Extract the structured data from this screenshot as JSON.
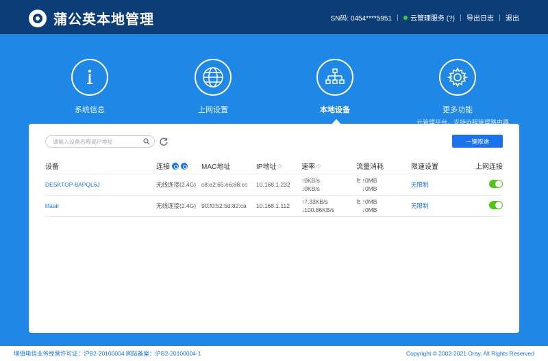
{
  "header": {
    "title": "蒲公英本地管理",
    "sn_label": "SN码: 0454****5951",
    "cloud_service": "云管理服务 (?)",
    "export_log": "导出日志",
    "logout": "退出",
    "status_color": "#2fd13c"
  },
  "nav": {
    "items": [
      {
        "label": "系统信息",
        "icon": "info-icon"
      },
      {
        "label": "上网设置",
        "icon": "globe-icon"
      },
      {
        "label": "本地设备",
        "icon": "network-icon"
      },
      {
        "label": "更多功能",
        "icon": "gear-icon",
        "sub": "云管理平台，支持远程管理路由器"
      }
    ],
    "active": "本地设备"
  },
  "toolbar": {
    "search_placeholder": "请输入设备名称或IP地址",
    "one_key_limit": "一键限速"
  },
  "table": {
    "headers": {
      "device": "设备",
      "connection": "连接",
      "mac": "MAC地址",
      "ip": "IP地址",
      "speed": "速率",
      "traffic": "流量消耗",
      "limit": "限速设置",
      "online": "上网连接"
    },
    "rows": [
      {
        "device": "DESKTOP-8APQL6J",
        "connection": "无线连接(2.4G)",
        "mac": "c8:e2:65:e6:88:cc",
        "ip": "10.168.1.232",
        "speed_up": "↑0KB/s",
        "speed_down": "↓0KB/s",
        "traffic_up": "↑0MB",
        "traffic_down": "↓0MB",
        "limit": "无限制",
        "online": true
      },
      {
        "device": "lifaair",
        "connection": "无线连接(2.4G)",
        "mac": "90:f0:52:5d:82:ca",
        "ip": "10.168.1.112",
        "speed_up": "↑7.33KB/s",
        "speed_down": "↓100.86KB/s",
        "traffic_up": "↑0MB",
        "traffic_down": "↓0MB",
        "limit": "无限制",
        "online": true
      }
    ]
  },
  "footer": {
    "license": "增值电信业务经营许可证：沪B2-20100004 网站备案：沪B2-20100004-1",
    "copyright": "Copyright © 2002-2021 Oray. All Rights Reserved"
  },
  "colors": {
    "header_bg": "#0b3d78",
    "page_bg": "#1f87e5",
    "accent": "#1a73e8",
    "toggle_on": "#52c41a"
  }
}
